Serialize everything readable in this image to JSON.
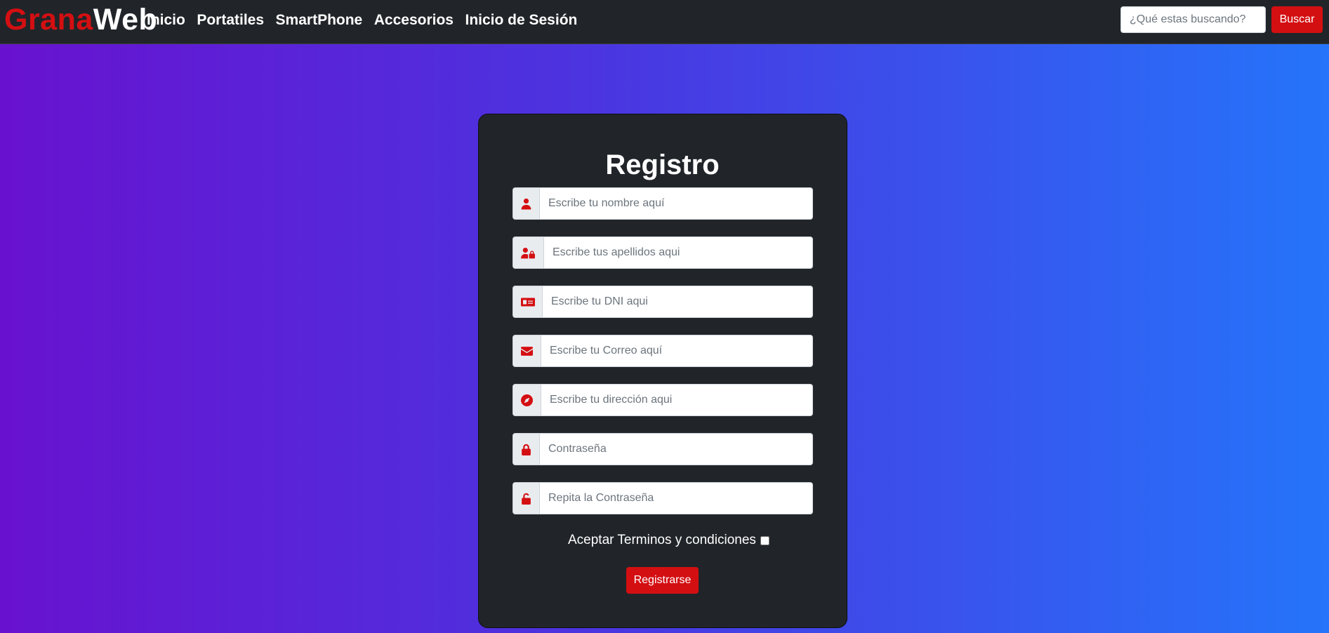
{
  "brand": {
    "part1": "Grana",
    "part2": "Web"
  },
  "nav": {
    "items": [
      "Inicio",
      "Portatiles",
      "SmartPhone",
      "Accesorios",
      "Inicio de Sesión"
    ]
  },
  "search": {
    "placeholder": "¿Qué estas buscando?",
    "button_label": "Buscar"
  },
  "form": {
    "title": "Registro",
    "fields": [
      {
        "icon": "user-icon",
        "placeholder": "Escribe tu nombre aquí"
      },
      {
        "icon": "user-lock-icon",
        "placeholder": "Escribe tus apellidos aqui"
      },
      {
        "icon": "id-card-icon",
        "placeholder": "Escribe tu DNI aqui"
      },
      {
        "icon": "envelope-icon",
        "placeholder": "Escribe tu Correo aquí"
      },
      {
        "icon": "compass-icon",
        "placeholder": "Escribe tu dirección aqui"
      },
      {
        "icon": "lock-icon",
        "placeholder": "Contraseña"
      },
      {
        "icon": "unlock-icon",
        "placeholder": "Repita la Contraseña"
      }
    ],
    "terms_label": "Aceptar Terminos y condiciones",
    "submit_label": "Registrarse"
  },
  "colors": {
    "accent": "#d40f12",
    "navbar": "#212529",
    "card": "#212529",
    "gradient_start": "#6812cf",
    "gradient_end": "#2574fa"
  }
}
